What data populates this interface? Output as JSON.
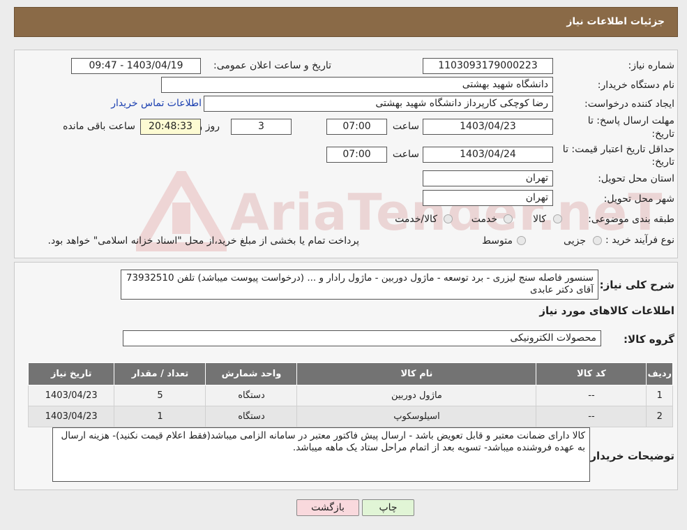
{
  "header": {
    "title": "جزئیات اطلاعات نیاز"
  },
  "form": {
    "need_number_label": "شماره نیاز:",
    "need_number": "1103093179000223",
    "announce_label": "تاریخ و ساعت اعلان عمومی:",
    "announce_value": "1403/04/19 - 09:47",
    "buyer_label": "نام دستگاه خریدار:",
    "buyer_value": "دانشگاه شهید بهشتی",
    "creator_label": "ایجاد کننده درخواست:",
    "creator_value": "رضا کوچکی کارپرداز دانشگاه شهید بهشتی",
    "contact_link": "اطلاعات تماس خریدار",
    "deadline_label_1": "مهلت ارسال پاسخ: تا",
    "deadline_label_2": "تاریخ:",
    "deadline_date": "1403/04/23",
    "time_label": "ساعت",
    "deadline_time": "07:00",
    "days_value": "3",
    "days_label": "روز و",
    "remaining_time": "20:48:33",
    "remaining_label": "ساعت باقی مانده",
    "validity_label_1": "حداقل تاریخ اعتبار قیمت: تا",
    "validity_label_2": "تاریخ:",
    "validity_date": "1403/04/24",
    "validity_time": "07:00",
    "province_label": "استان محل تحویل:",
    "province_value": "تهران",
    "city_label": "شهر محل تحویل:",
    "city_value": "تهران",
    "category_label": "طبقه بندی موضوعی:",
    "category_options": [
      "کالا",
      "خدمت",
      "کالا/خدمت"
    ],
    "process_label": "نوع فرآیند خرید :",
    "process_options": [
      "جزیی",
      "متوسط"
    ],
    "process_note": "پرداخت تمام یا بخشی از مبلغ خرید،از محل \"اسناد خزانه اسلامی\" خواهد بود."
  },
  "description": {
    "label": "شرح کلی نیاز:",
    "text": "سنسور فاصله سنج لیزری - برد توسعه - ماژول دوربین - ماژول رادار و ... (درخواست پیوست میباشد) تلفن 73932510 آقای دکتر عابدی",
    "items_title": "اطلاعات کالاهای مورد نیاز",
    "group_label": "گروه کالا:",
    "group_value": "محصولات الکترونیکی"
  },
  "table": {
    "headers": [
      "ردیف",
      "کد کالا",
      "نام کالا",
      "واحد شمارش",
      "تعداد / مقدار",
      "تاریخ نیاز"
    ],
    "rows": [
      [
        "1",
        "--",
        "ماژول دوربین",
        "دستگاه",
        "5",
        "1403/04/23"
      ],
      [
        "2",
        "--",
        "اسیلوسکوپ",
        "دستگاه",
        "1",
        "1403/04/23"
      ]
    ]
  },
  "buyer_notes": {
    "label": "توضیحات خریدار:",
    "text": "کالا دارای ضمانت معتبر و قابل تعویض باشد -  ارسال پیش فاکتور معتبر در سامانه الزامی میباشد(فقط اعلام قیمت نکنید)- هزینه ارسال به عهده فروشنده میباشد- تسویه بعد از اتمام مراحل ستاد یک ماهه میباشد."
  },
  "buttons": {
    "print": "چاپ",
    "back": "بازگشت"
  },
  "watermark": {
    "text": "AriaTender.neT"
  },
  "colors": {
    "header_bg": "#8a6a47",
    "table_header": "#737373",
    "back_button": "#f9d9dd",
    "print_button": "#e1f5d6"
  }
}
